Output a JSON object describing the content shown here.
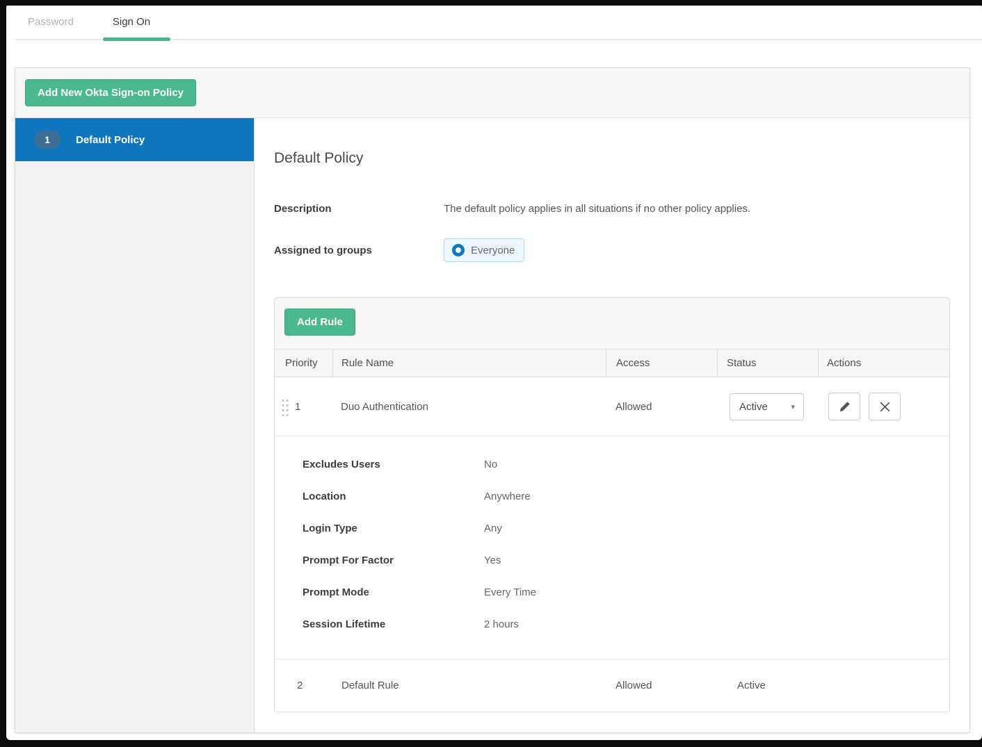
{
  "tabs": [
    {
      "label": "Password"
    },
    {
      "label": "Sign On"
    }
  ],
  "toolbar": {
    "add_policy_label": "Add New Okta Sign-on Policy"
  },
  "sidebar": {
    "items": [
      {
        "priority": "1",
        "label": "Default Policy",
        "selected": true
      }
    ]
  },
  "policy": {
    "title": "Default Policy",
    "description_label": "Description",
    "description_value": "The default policy applies in all situations if no other policy applies.",
    "assigned_label": "Assigned to groups",
    "assigned_value": "Everyone",
    "rules": {
      "add_rule_label": "Add Rule",
      "columns": {
        "priority": "Priority",
        "rule_name": "Rule Name",
        "access": "Access",
        "status": "Status",
        "actions": "Actions"
      },
      "rows": [
        {
          "priority": "1",
          "name": "Duo Authentication",
          "access": "Allowed",
          "status": "Active",
          "details": [
            {
              "label": "Excludes Users",
              "value": "No"
            },
            {
              "label": "Location",
              "value": "Anywhere"
            },
            {
              "label": "Login Type",
              "value": "Any"
            },
            {
              "label": "Prompt For Factor",
              "value": "Yes"
            },
            {
              "label": "Prompt Mode",
              "value": "Every Time"
            },
            {
              "label": "Session Lifetime",
              "value": "2 hours"
            }
          ]
        },
        {
          "priority": "2",
          "name": "Default Rule",
          "access": "Allowed",
          "status": "Active"
        }
      ]
    }
  },
  "icons": {
    "caret_down": "▾",
    "everyone_group": "blue-ring-group-icon",
    "edit": "pencil-icon",
    "remove": "x-icon",
    "drag": "drag-dots-icon"
  },
  "colors": {
    "accent_green": "#4BB890",
    "brand_blue": "#0F75BD",
    "badge_blue": "#3E6D94",
    "chip_bg": "#EDF8FE",
    "chip_border": "#ABDCF4",
    "frame_black": "#0D0D0D"
  }
}
